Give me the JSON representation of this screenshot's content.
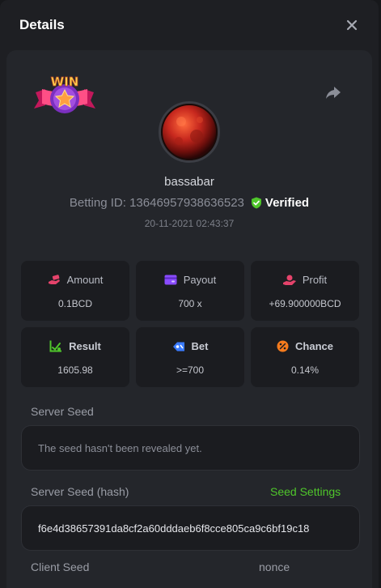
{
  "header": {
    "title": "Details"
  },
  "user": {
    "name": "bassabar",
    "betting_id": "Betting ID: 13646957938636523",
    "verified_label": "Verified",
    "timestamp": "20-11-2021 02:43:37",
    "badge_text": "WIN"
  },
  "stats": [
    {
      "label": "Amount",
      "value": "0.1BCD",
      "icon": "money-hand-icon",
      "color": "#e5436b"
    },
    {
      "label": "Payout",
      "value": "700 x",
      "icon": "wallet-icon",
      "color": "#8a4bff"
    },
    {
      "label": "Profit",
      "value": "+69.900000BCD",
      "icon": "profit-hand-icon",
      "color": "#e5436b"
    },
    {
      "label": "Result",
      "value": "1605.98",
      "icon": "chart-check-icon",
      "color": "#4fc62b"
    },
    {
      "label": "Bet",
      "value": ">=700",
      "icon": "tag-icon",
      "color": "#3a7bff"
    },
    {
      "label": "Chance",
      "value": "0.14%",
      "icon": "percent-icon",
      "color": "#f57b1d"
    }
  ],
  "server_seed": {
    "label": "Server Seed",
    "value": "The seed hasn't been revealed yet."
  },
  "server_seed_hash": {
    "label": "Server Seed (hash)",
    "settings_link": "Seed Settings",
    "value": "f6e4d38657391da8cf2a60dddaeb6f8cce805ca9c6bf19c18"
  },
  "client_seed": {
    "label": "Client Seed"
  },
  "nonce": {
    "label": "nonce"
  },
  "colors": {
    "accent_green": "#4fc62b",
    "panel": "#24262b",
    "card": "#1b1c20"
  }
}
